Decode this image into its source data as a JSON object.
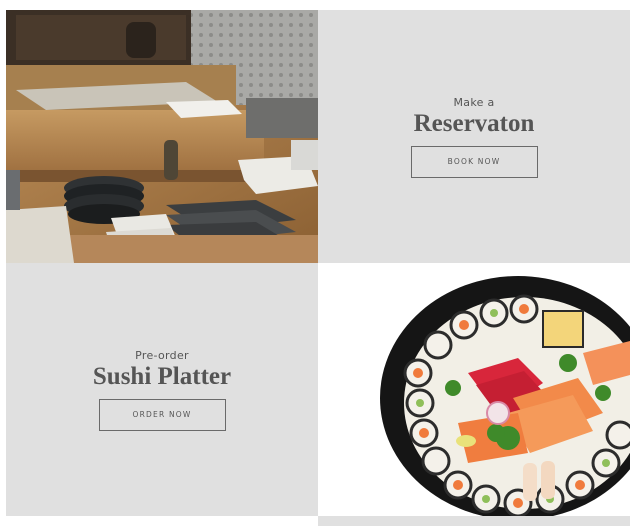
{
  "reservation": {
    "kicker": "Make a",
    "title": "Reservaton",
    "button": "BOOK NOW"
  },
  "preorder": {
    "kicker": "Pre-order",
    "title": "Sushi Platter",
    "button": "ORDER NOW"
  },
  "colors": {
    "panel_bg": "#e0e0e0",
    "text": "#555555",
    "border": "#6a6a6a"
  }
}
